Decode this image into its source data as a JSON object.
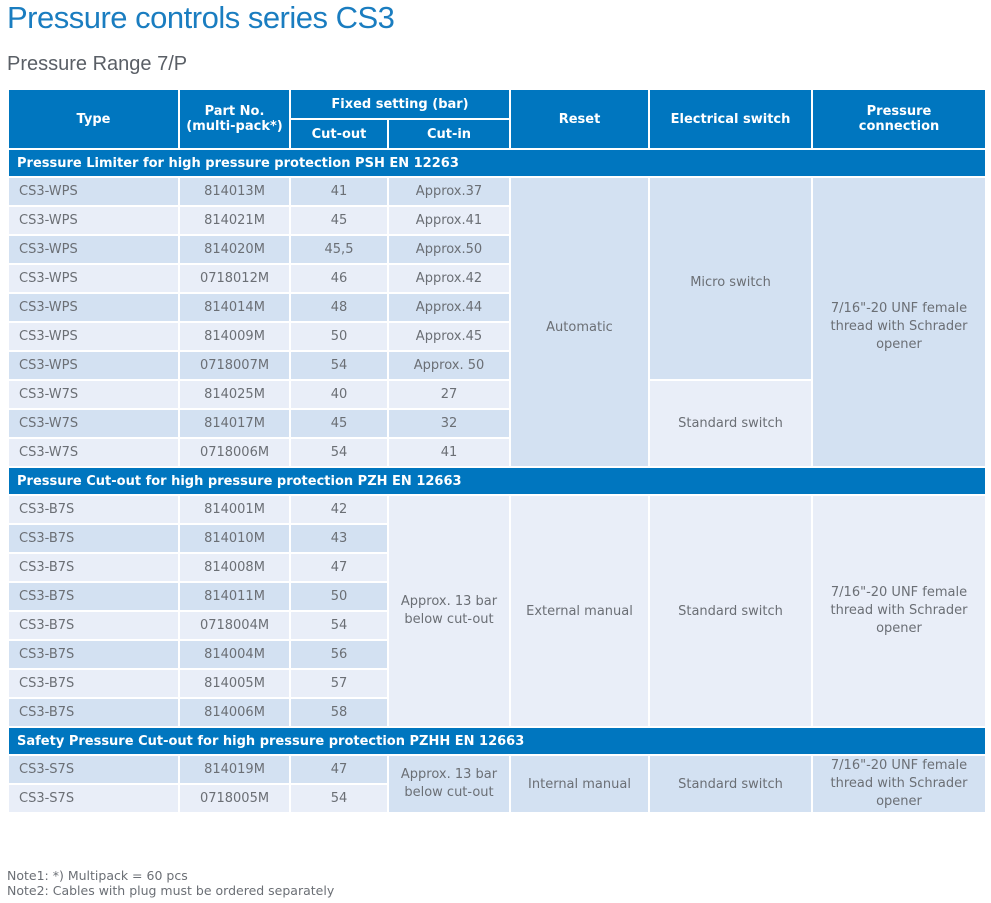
{
  "title": "Pressure controls series CS3",
  "subtitle": "Pressure Range 7/P",
  "header": {
    "type": "Type",
    "part_no_1": "Part No.",
    "part_no_2": "(multi-pack*)",
    "fixed_setting": "Fixed setting (bar)",
    "cut_out": "Cut-out",
    "cut_in": "Cut-in",
    "reset": "Reset",
    "electrical_switch": "Electrical switch",
    "pressure_connection_1": "Pressure",
    "pressure_connection_2": "connection"
  },
  "sections": [
    {
      "title": "Pressure Limiter for high pressure protection PSH EN 12263",
      "reset": "Automatic",
      "switch_a": "Micro switch",
      "switch_b": "Standard switch",
      "connection": "7/16\"-20 UNF female thread with Schrader opener",
      "rows": [
        {
          "type": "CS3-WPS",
          "part": "814013M",
          "cut_out": "41",
          "cut_in": "Approx.37"
        },
        {
          "type": "CS3-WPS",
          "part": "814021M",
          "cut_out": "45",
          "cut_in": "Approx.41"
        },
        {
          "type": "CS3-WPS",
          "part": "814020M",
          "cut_out": "45,5",
          "cut_in": "Approx.50"
        },
        {
          "type": "CS3-WPS",
          "part": "0718012M",
          "cut_out": "46",
          "cut_in": "Approx.42"
        },
        {
          "type": "CS3-WPS",
          "part": "814014M",
          "cut_out": "48",
          "cut_in": "Approx.44"
        },
        {
          "type": "CS3-WPS",
          "part": "814009M",
          "cut_out": "50",
          "cut_in": "Approx.45"
        },
        {
          "type": "CS3-WPS",
          "part": "0718007M",
          "cut_out": "54",
          "cut_in": "Approx. 50"
        },
        {
          "type": "CS3-W7S",
          "part": "814025M",
          "cut_out": "40",
          "cut_in": "27"
        },
        {
          "type": "CS3-W7S",
          "part": "814017M",
          "cut_out": "45",
          "cut_in": "32"
        },
        {
          "type": "CS3-W7S",
          "part": "0718006M",
          "cut_out": "54",
          "cut_in": "41"
        }
      ]
    },
    {
      "title": "Pressure Cut-out for high pressure protection PZH EN 12663",
      "cut_in": "Approx. 13 bar below cut-out",
      "reset": "External manual",
      "switch": "Standard switch",
      "connection": "7/16\"-20 UNF female thread with Schrader opener",
      "rows": [
        {
          "type": "CS3-B7S",
          "part": "814001M",
          "cut_out": "42"
        },
        {
          "type": "CS3-B7S",
          "part": "814010M",
          "cut_out": "43"
        },
        {
          "type": "CS3-B7S",
          "part": "814008M",
          "cut_out": "47"
        },
        {
          "type": "CS3-B7S",
          "part": "814011M",
          "cut_out": "50"
        },
        {
          "type": "CS3-B7S",
          "part": "0718004M",
          "cut_out": "54"
        },
        {
          "type": "CS3-B7S",
          "part": "814004M",
          "cut_out": "56"
        },
        {
          "type": "CS3-B7S",
          "part": "814005M",
          "cut_out": "57"
        },
        {
          "type": "CS3-B7S",
          "part": "814006M",
          "cut_out": "58"
        }
      ]
    },
    {
      "title": "Safety Pressure Cut-out for high pressure protection PZHH EN 12663",
      "cut_in": "Approx. 13 bar below cut-out",
      "reset": "Internal manual",
      "switch": "Standard switch",
      "connection": "7/16\"-20 UNF female thread with Schrader opener",
      "rows": [
        {
          "type": "CS3-S7S",
          "part": "814019M",
          "cut_out": "47"
        },
        {
          "type": "CS3-S7S",
          "part": "0718005M",
          "cut_out": "54"
        }
      ]
    }
  ],
  "notes": [
    "Note1: *) Multipack = 60 pcs",
    "Note2: Cables with plug must be ordered separately"
  ],
  "colors": {
    "brand_blue": "#0076bf",
    "row_dark": "#d3e1f2",
    "row_light": "#e9eef8"
  }
}
